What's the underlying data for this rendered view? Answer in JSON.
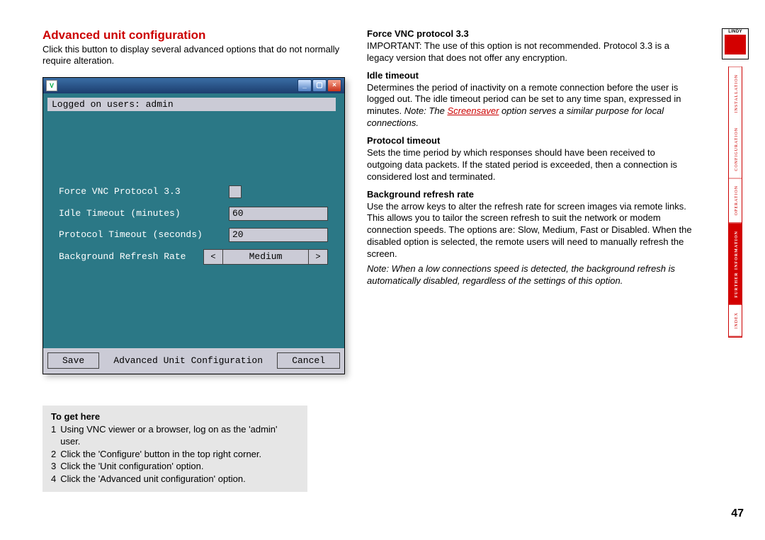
{
  "title": "Advanced unit configuration",
  "intro": "Click this button to display several advanced options that do not normally require alteration.",
  "screenshot": {
    "vnc_badge": "V",
    "user_line": "Logged on users: admin",
    "rows": {
      "force": {
        "label": "Force VNC Protocol 3.3"
      },
      "idle": {
        "label": "Idle Timeout (minutes)",
        "value": "60"
      },
      "proto": {
        "label": "Protocol Timeout (seconds)",
        "value": "20"
      },
      "rate": {
        "label": "Background Refresh Rate",
        "value": "Medium",
        "left": "<",
        "right": ">"
      }
    },
    "buttons": {
      "save": "Save",
      "caption": "Advanced Unit Configuration",
      "cancel": "Cancel"
    }
  },
  "helpbox": {
    "title": "To get here",
    "steps": [
      "Using VNC viewer or a browser, log on as the 'admin' user.",
      "Click the 'Configure' button in the top right corner.",
      "Click the 'Unit configuration' option.",
      "Click the 'Advanced unit configuration' option."
    ]
  },
  "right": {
    "force": {
      "hd": "Force VNC protocol 3.3",
      "body": "IMPORTANT: The use of this option is not recommended. Protocol 3.3 is a legacy version that does not offer any encryption."
    },
    "idle": {
      "hd": "Idle timeout",
      "body": "Determines the period of inactivity on a remote connection before the user is logged out. The idle timeout period can be set to any time span, expressed in minutes. ",
      "note_pre": "Note: The ",
      "ss": "Screensaver",
      "note_post": " option serves a similar purpose for local connections."
    },
    "proto": {
      "hd": "Protocol timeout",
      "body": "Sets the time period by which responses should have been received to outgoing data packets. If the stated period is exceeded, then a connection is considered lost and terminated."
    },
    "rate": {
      "hd": "Background refresh rate",
      "body": "Use the arrow keys to alter the refresh rate for screen images via remote links. This allows you to tailor the screen refresh to suit the network or modem connection speeds. The options are: Slow, Medium, Fast or Disabled. When the disabled option is selected, the remote users will need to manually refresh the screen.",
      "note": "Note: When a low connections speed is detected, the background refresh is automatically disabled, regardless of the settings of this option."
    }
  },
  "nav": {
    "logo": "LINDY",
    "items": [
      "installation",
      "configuration",
      "operation",
      "further information",
      "index"
    ]
  },
  "pagenum": "47"
}
